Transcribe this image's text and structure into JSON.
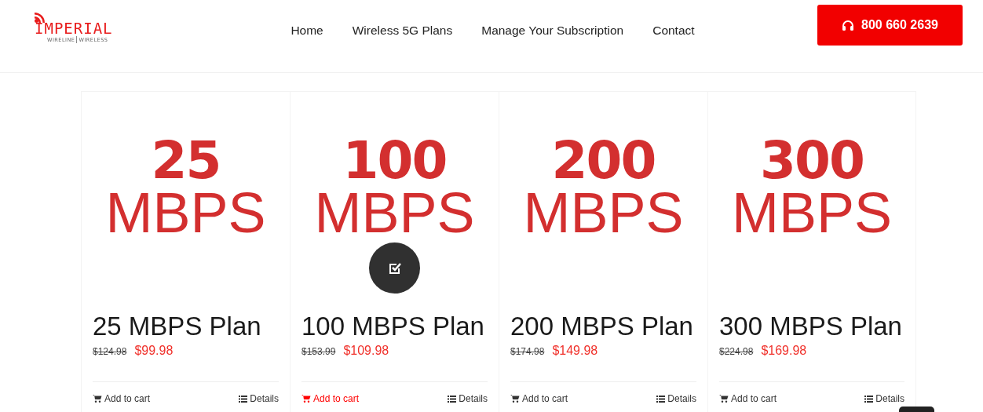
{
  "logo": {
    "name": "IMPERIAL",
    "tagline_left": "WIRELINE",
    "tagline_right": "WIRELESS"
  },
  "nav": [
    {
      "label": "Home"
    },
    {
      "label": "Wireless 5G Plans"
    },
    {
      "label": "Manage Your Subscription"
    },
    {
      "label": "Contact"
    }
  ],
  "phone_button": {
    "label": "800 660 2639"
  },
  "products": [
    {
      "image_number": "25",
      "image_unit": "MBPS",
      "title": "25 MBPS Plan",
      "old_price": "$124.98",
      "price": "$99.98",
      "add_to_cart": "Add to cart",
      "details": "Details",
      "hovered": false
    },
    {
      "image_number": "100",
      "image_unit": "MBPS",
      "title": "100 MBPS Plan",
      "old_price": "$153.99",
      "price": "$109.98",
      "add_to_cart": "Add to cart",
      "details": "Details",
      "hovered": true
    },
    {
      "image_number": "200",
      "image_unit": "MBPS",
      "title": "200 MBPS Plan",
      "old_price": "$174.98",
      "price": "$149.98",
      "add_to_cart": "Add to cart",
      "details": "Details",
      "hovered": false
    },
    {
      "image_number": "300",
      "image_unit": "MBPS",
      "title": "300 MBPS Plan",
      "old_price": "$224.98",
      "price": "$169.98",
      "add_to_cart": "Add to cart",
      "details": "Details",
      "hovered": false
    }
  ]
}
